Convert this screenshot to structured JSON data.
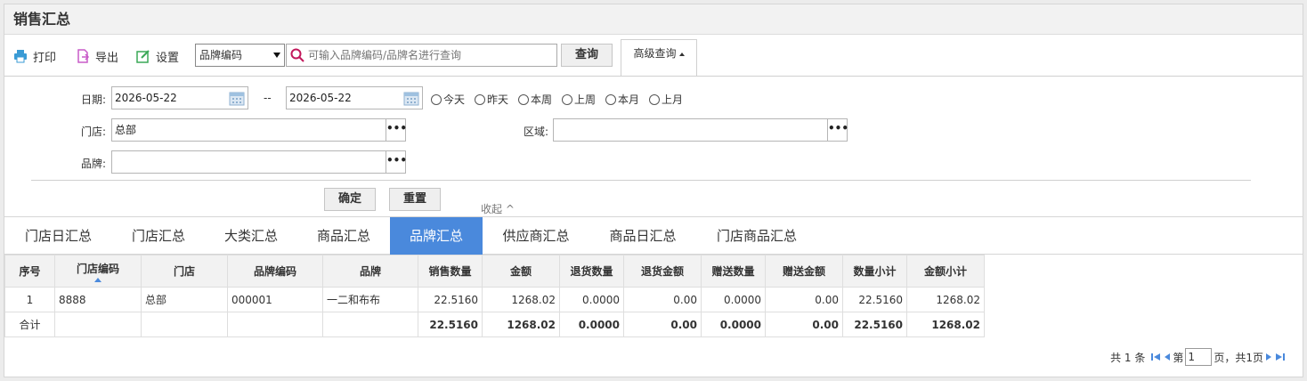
{
  "page": {
    "title": "销售汇总"
  },
  "toolbar": {
    "print_label": "打印",
    "export_label": "导出",
    "settings_label": "设置",
    "search_field_select": "品牌编码",
    "search_placeholder": "可输入品牌编码/品牌名进行查询",
    "query_label": "查询",
    "advanced_label": "高级查询"
  },
  "filter": {
    "date_label": "日期:",
    "date_from": "2026-05-22",
    "date_sep": "--",
    "date_to": "2026-05-22",
    "quick_dates": [
      "今天",
      "昨天",
      "本周",
      "上周",
      "本月",
      "上月"
    ],
    "store_label": "门店:",
    "store_value": "总部",
    "area_label": "区域:",
    "area_value": "",
    "brand_label": "品牌:",
    "brand_value": "",
    "dots": "•••",
    "confirm_label": "确定",
    "reset_label": "重置",
    "collapse_label": "收起 ^"
  },
  "tabs": [
    "门店日汇总",
    "门店汇总",
    "大类汇总",
    "商品汇总",
    "品牌汇总",
    "供应商汇总",
    "商品日汇总",
    "门店商品汇总"
  ],
  "active_tab_index": 4,
  "table": {
    "columns": [
      "序号",
      "门店编码",
      "门店",
      "品牌编码",
      "品牌",
      "销售数量",
      "金额",
      "退货数量",
      "退货金额",
      "赠送数量",
      "赠送金额",
      "数量小计",
      "金额小计"
    ],
    "rows": [
      [
        "1",
        "8888",
        "总部",
        "000001",
        "一二和布布",
        "22.5160",
        "1268.02",
        "0.0000",
        "0.00",
        "0.0000",
        "0.00",
        "22.5160",
        "1268.02"
      ]
    ],
    "total": [
      "合计",
      "",
      "",
      "",
      "",
      "22.5160",
      "1268.02",
      "0.0000",
      "0.00",
      "0.0000",
      "0.00",
      "22.5160",
      "1268.02"
    ]
  },
  "pager": {
    "total_text": "共 1 条",
    "page_prefix": "第",
    "page_value": "1",
    "page_suffix": "页，共1页"
  },
  "colors": {
    "accent": "#4a89dc",
    "print_icon": "#3a9bd5",
    "export_icon": "#c85bc8",
    "settings_icon": "#3aa857",
    "search_icon": "#c2185b"
  }
}
